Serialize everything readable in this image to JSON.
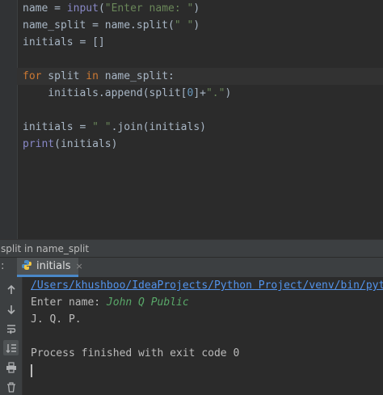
{
  "editor": {
    "line1": {
      "a": "name = ",
      "b": "input",
      "c": "(",
      "d": "\"Enter name: \"",
      "e": ")"
    },
    "line2": {
      "a": "name_split = name.split(",
      "b": "\" \"",
      "c": ")"
    },
    "line3": {
      "a": "initials = []"
    },
    "line5": {
      "kw1": "for",
      "a": " split ",
      "kw2": "in",
      "b": " name_split:"
    },
    "line6": {
      "a": "    initials.append(split[",
      "num": "0",
      "b": "]+",
      "str": "\".\"",
      "c": ")"
    },
    "line8": {
      "a": "initials = ",
      "str": "\" \"",
      "b": ".join(initials)"
    },
    "line9": {
      "fn": "print",
      "a": "(initials)"
    }
  },
  "breadcrumb": "split in name_split",
  "run_panel": {
    "colon": ":",
    "tab_label": "initials",
    "tab_close": "×"
  },
  "console": {
    "path": "/Users/khushboo/IdeaProjects/Python Project/venv/bin/python",
    "prompt": "Enter name: ",
    "input_value": "John Q Public",
    "output": "J. Q. P.",
    "exit_message": "Process finished with exit code 0"
  },
  "icons": [
    "up-arrow-icon",
    "down-arrow-icon",
    "soft-wrap-icon",
    "scroll-to-end-icon",
    "print-icon",
    "trash-icon"
  ],
  "colors": {
    "background": "#2b2b2b",
    "keyword": "#cc7832",
    "string": "#6a8759",
    "link": "#5394ec",
    "user_input": "#59a869"
  }
}
